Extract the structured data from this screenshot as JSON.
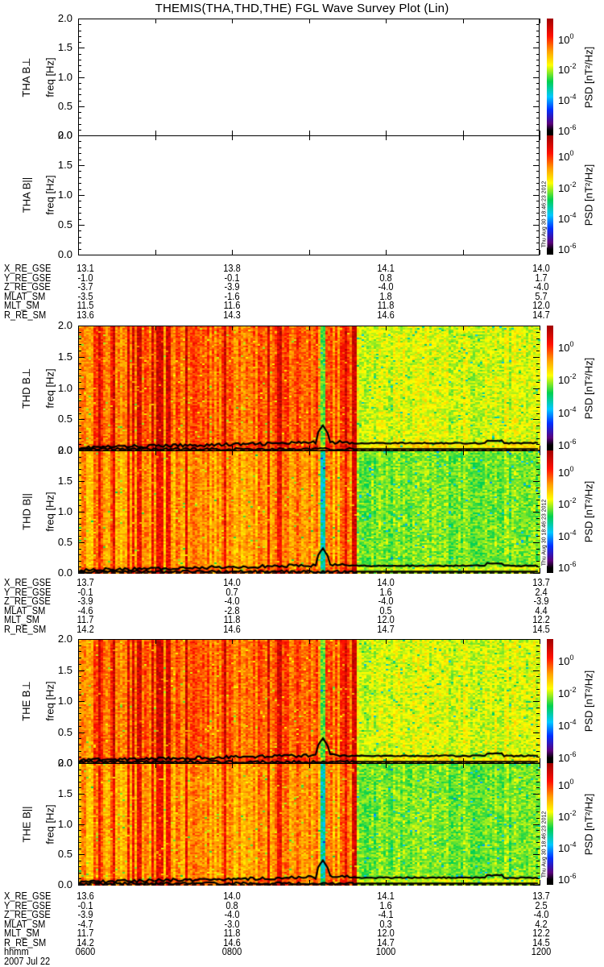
{
  "title": "THEMIS(THA,THD,THE) FGL Wave Survey Plot (Lin)",
  "timestamp": "Thu Aug 30 18:46:23 2012",
  "colors": {
    "line": "#000000",
    "background": "#ffffff"
  },
  "panels": [
    {
      "label": "THA B⊥",
      "ylabel": "freq [Hz]",
      "has_data": false
    },
    {
      "label": "THA B||",
      "ylabel": "freq [Hz]",
      "has_data": false
    },
    {
      "label": "THD B⊥",
      "ylabel": "freq [Hz]",
      "has_data": true,
      "component": "perp"
    },
    {
      "label": "THD B||",
      "ylabel": "freq [Hz]",
      "has_data": true,
      "component": "par"
    },
    {
      "label": "THE B⊥",
      "ylabel": "freq [Hz]",
      "has_data": true,
      "component": "perp"
    },
    {
      "label": "THE B||",
      "ylabel": "freq [Hz]",
      "has_data": true,
      "component": "par"
    }
  ],
  "colorbar": {
    "label": "PSD [nT²/Hz]",
    "ticks": [
      {
        "base": "10",
        "exp": "0"
      },
      {
        "base": "10",
        "exp": "-2"
      },
      {
        "base": "10",
        "exp": "-4"
      },
      {
        "base": "10",
        "exp": "-6"
      }
    ],
    "range_log10": [
      -6.5,
      1.2
    ]
  },
  "ephemeris": [
    {
      "probe": "THA",
      "rows": [
        {
          "label": "X_RE_GSE",
          "values": [
            "13.1",
            "13.8",
            "14.1",
            "14.0"
          ]
        },
        {
          "label": "Y_RE_GSE",
          "values": [
            "-1.0",
            "-0.1",
            "0.8",
            "1.7"
          ]
        },
        {
          "label": "Z_RE_GSE",
          "values": [
            "-3.7",
            "-3.9",
            "-4.0",
            "-4.0"
          ]
        },
        {
          "label": "MLAT_SM",
          "values": [
            "-3.5",
            "-1.6",
            "1.8",
            "5.7"
          ]
        },
        {
          "label": "MLT_SM",
          "values": [
            "11.5",
            "11.6",
            "11.8",
            "12.0"
          ]
        },
        {
          "label": "R_RE_SM",
          "values": [
            "13.6",
            "14.3",
            "14.6",
            "14.7"
          ]
        }
      ]
    },
    {
      "probe": "THD",
      "rows": [
        {
          "label": "X_RE_GSE",
          "values": [
            "13.7",
            "14.0",
            "14.0",
            "13.7"
          ]
        },
        {
          "label": "Y_RE_GSE",
          "values": [
            "-0.1",
            "0.7",
            "1.6",
            "2.4"
          ]
        },
        {
          "label": "Z_RE_GSE",
          "values": [
            "-3.9",
            "-4.0",
            "-4.0",
            "-3.9"
          ]
        },
        {
          "label": "MLAT_SM",
          "values": [
            "-4.6",
            "-2.8",
            "0.5",
            "4.4"
          ]
        },
        {
          "label": "MLT_SM",
          "values": [
            "11.7",
            "11.8",
            "12.0",
            "12.2"
          ]
        },
        {
          "label": "R_RE_SM",
          "values": [
            "14.2",
            "14.6",
            "14.7",
            "14.5"
          ]
        }
      ]
    },
    {
      "probe": "THE",
      "rows": [
        {
          "label": "X_RE_GSE",
          "values": [
            "13.6",
            "14.0",
            "14.1",
            "13.7"
          ]
        },
        {
          "label": "Y_RE_GSE",
          "values": [
            "-0.1",
            "0.8",
            "1.6",
            "2.5"
          ]
        },
        {
          "label": "Z_RE_GSE",
          "values": [
            "-3.9",
            "-4.0",
            "-4.1",
            "-4.0"
          ]
        },
        {
          "label": "MLAT_SM",
          "values": [
            "-4.7",
            "-3.0",
            "0.3",
            "4.2"
          ]
        },
        {
          "label": "MLT_SM",
          "values": [
            "11.7",
            "11.8",
            "12.0",
            "12.2"
          ]
        },
        {
          "label": "R_RE_SM",
          "values": [
            "14.2",
            "14.6",
            "14.7",
            "14.5"
          ]
        }
      ]
    }
  ],
  "time_axis": {
    "label": "hhmm",
    "ticks": [
      "0600",
      "0800",
      "1000",
      "1200"
    ],
    "date": "2007 Jul 22"
  },
  "chart_data": {
    "type": "heatmap",
    "title": "THEMIS(THA,THD,THE) FGL Wave Survey Plot (Lin)",
    "xlabel": "hhmm",
    "ylabel": "freq [Hz]",
    "xlim_hours": [
      6,
      12
    ],
    "ylim": [
      0,
      2
    ],
    "yticks": [
      "0.0",
      "0.5",
      "1.0",
      "1.5",
      "2.0"
    ],
    "zlabel": "PSD [nT²/Hz]",
    "z_scale": "log",
    "features": {
      "enhanced_power_until_hour": 9.58,
      "quiet_cyan_band_hours": [
        9.17,
        9.22
      ],
      "strong_band_hour": 9.57,
      "line_upper_hz_before": 0.12,
      "line_upper_peak": {
        "hour": 9.18,
        "freq": 0.42
      },
      "line_upper_hz_after": 0.12,
      "line_lower_hz": 0.03
    }
  }
}
